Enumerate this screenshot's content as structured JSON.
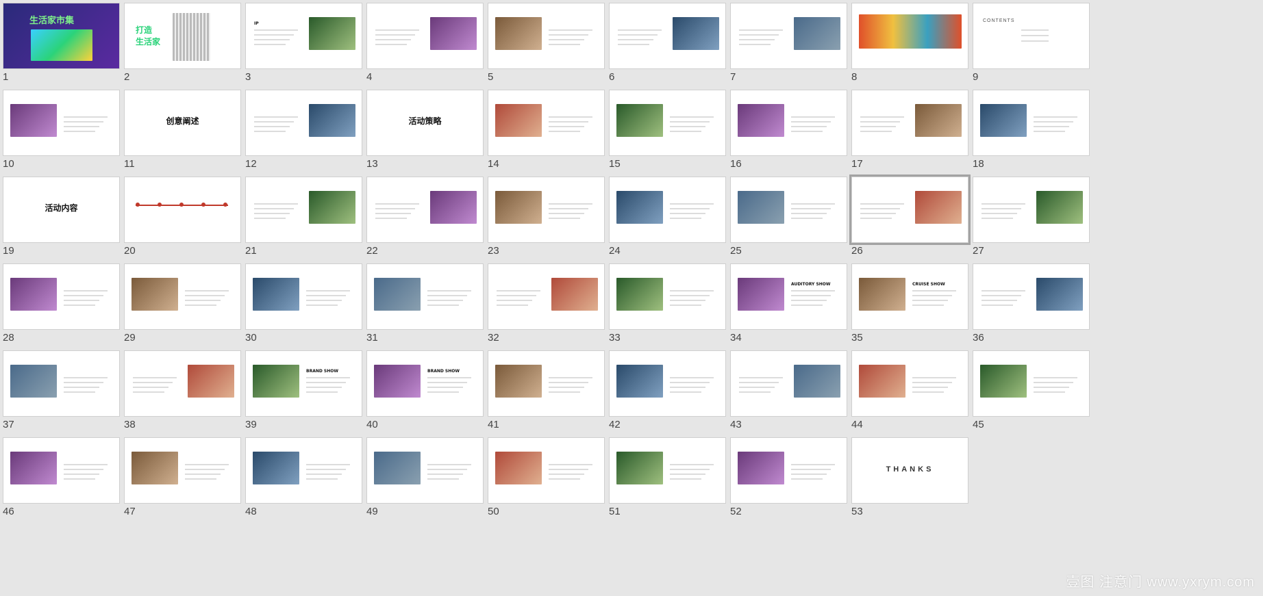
{
  "app": {
    "view": "slide-sorter"
  },
  "colors": {
    "background": "#e6e6e6",
    "accent_green": "#2bd37a",
    "accent_red": "#c0392b",
    "selected_outline": "#a3a3a3"
  },
  "slides": [
    {
      "n": "1",
      "title": "生活家市集",
      "style": "cover"
    },
    {
      "n": "2",
      "title": "打造 生活家",
      "style": "green"
    },
    {
      "n": "3",
      "title": "IP",
      "style": "text"
    },
    {
      "n": "4",
      "title": "",
      "style": "text-img"
    },
    {
      "n": "5",
      "title": "",
      "style": "img-text"
    },
    {
      "n": "6",
      "title": "",
      "style": "text-img"
    },
    {
      "n": "7",
      "title": "",
      "style": "text"
    },
    {
      "n": "8",
      "title": "",
      "style": "banner"
    },
    {
      "n": "9",
      "title": "CONTENTS",
      "style": "contents"
    },
    {
      "n": "10",
      "title": "",
      "style": "img-text"
    },
    {
      "n": "11",
      "title": "创意阐述",
      "style": "section"
    },
    {
      "n": "12",
      "title": "",
      "style": "text-img"
    },
    {
      "n": "13",
      "title": "活动策略",
      "style": "section"
    },
    {
      "n": "14",
      "title": "",
      "style": "img-text"
    },
    {
      "n": "15",
      "title": "",
      "style": "img-text"
    },
    {
      "n": "16",
      "title": "",
      "style": "img-text"
    },
    {
      "n": "17",
      "title": "",
      "style": "text-img"
    },
    {
      "n": "18",
      "title": "",
      "style": "img-text"
    },
    {
      "n": "19",
      "title": "活动内容",
      "style": "section"
    },
    {
      "n": "20",
      "title": "",
      "style": "timeline"
    },
    {
      "n": "21",
      "title": "",
      "style": "text-img"
    },
    {
      "n": "22",
      "title": "",
      "style": "text-img"
    },
    {
      "n": "23",
      "title": "",
      "style": "img-text"
    },
    {
      "n": "24",
      "title": "",
      "style": "img-text"
    },
    {
      "n": "25",
      "title": "",
      "style": "img-text"
    },
    {
      "n": "26",
      "title": "",
      "style": "text-img"
    },
    {
      "n": "27",
      "title": "",
      "style": "text-img"
    },
    {
      "n": "28",
      "title": "",
      "style": "img-text"
    },
    {
      "n": "29",
      "title": "",
      "style": "img-text"
    },
    {
      "n": "30",
      "title": "",
      "style": "img-text"
    },
    {
      "n": "31",
      "title": "",
      "style": "img-text"
    },
    {
      "n": "32",
      "title": "",
      "style": "text-img"
    },
    {
      "n": "33",
      "title": "",
      "style": "img-text"
    },
    {
      "n": "34",
      "title": "AUDITORY SHOW",
      "style": "img-text"
    },
    {
      "n": "35",
      "title": "CRUISE SHOW",
      "style": "img-text"
    },
    {
      "n": "36",
      "title": "",
      "style": "text-img"
    },
    {
      "n": "37",
      "title": "",
      "style": "img-text"
    },
    {
      "n": "38",
      "title": "",
      "style": "text-img"
    },
    {
      "n": "39",
      "title": "BRAND SHOW",
      "style": "img-text"
    },
    {
      "n": "40",
      "title": "BRAND SHOW",
      "style": "img-text"
    },
    {
      "n": "41",
      "title": "",
      "style": "img-text"
    },
    {
      "n": "42",
      "title": "",
      "style": "img-text"
    },
    {
      "n": "43",
      "title": "",
      "style": "text-img"
    },
    {
      "n": "44",
      "title": "",
      "style": "img-text"
    },
    {
      "n": "45",
      "title": "",
      "style": "img-text"
    },
    {
      "n": "46",
      "title": "",
      "style": "img-text"
    },
    {
      "n": "47",
      "title": "",
      "style": "img-text"
    },
    {
      "n": "48",
      "title": "",
      "style": "img-text"
    },
    {
      "n": "49",
      "title": "",
      "style": "img-text"
    },
    {
      "n": "50",
      "title": "",
      "style": "img-text"
    },
    {
      "n": "51",
      "title": "",
      "style": "img-text"
    },
    {
      "n": "52",
      "title": "",
      "style": "img-text"
    },
    {
      "n": "53",
      "title": "THANKS",
      "style": "thanks"
    }
  ],
  "selected_slide": "26",
  "watermark": "壹图 注意门 www.yxrym.com"
}
